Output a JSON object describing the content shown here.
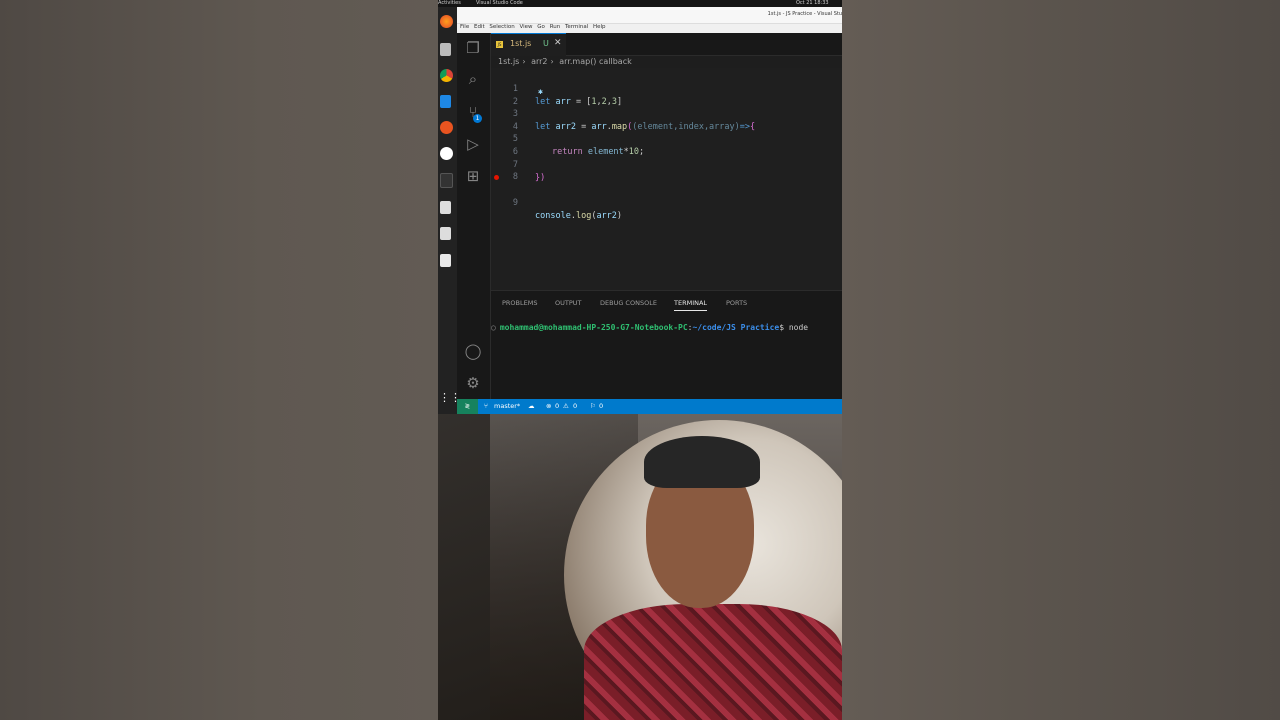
{
  "system": {
    "activities_label": "Activities",
    "app_name": "Visual Studio Code",
    "clock": "Oct 21 18:33"
  },
  "window": {
    "title": "1st.js - JS Practice - Visual Stu",
    "menus": [
      "File",
      "Edit",
      "Selection",
      "View",
      "Go",
      "Run",
      "Terminal",
      "Help"
    ]
  },
  "editor": {
    "tab_name": "1st.js",
    "tab_status": "U",
    "breadcrumb": [
      "1st.js",
      "arr2",
      "arr.map() callback"
    ],
    "lines": [
      {
        "n": "1",
        "text": "let arr = [1,2,3]"
      },
      {
        "n": "2",
        "text": ""
      },
      {
        "n": "3",
        "text": "let arr2 = arr.map((element,index,array)=>{"
      },
      {
        "n": "4",
        "text": ""
      },
      {
        "n": "5",
        "text": "return element*10;"
      },
      {
        "n": "6",
        "text": ""
      },
      {
        "n": "7",
        "text": "})"
      },
      {
        "n": "8",
        "text": ""
      },
      {
        "n": "9",
        "text": "console.log(arr2)"
      }
    ]
  },
  "panel": {
    "tabs": [
      "PROBLEMS",
      "OUTPUT",
      "DEBUG CONSOLE",
      "TERMINAL",
      "PORTS"
    ],
    "active_tab": "TERMINAL",
    "terminal_user": "mohammad@mohammad-HP-250-G7-Notebook-PC",
    "terminal_path": "~/code/JS Practice",
    "terminal_cmd": "$ node"
  },
  "status_bar": {
    "branch": "master*",
    "errors": "0",
    "warnings": "0",
    "ports": "0"
  },
  "activity_bar": {
    "source_control_badge": "1"
  }
}
